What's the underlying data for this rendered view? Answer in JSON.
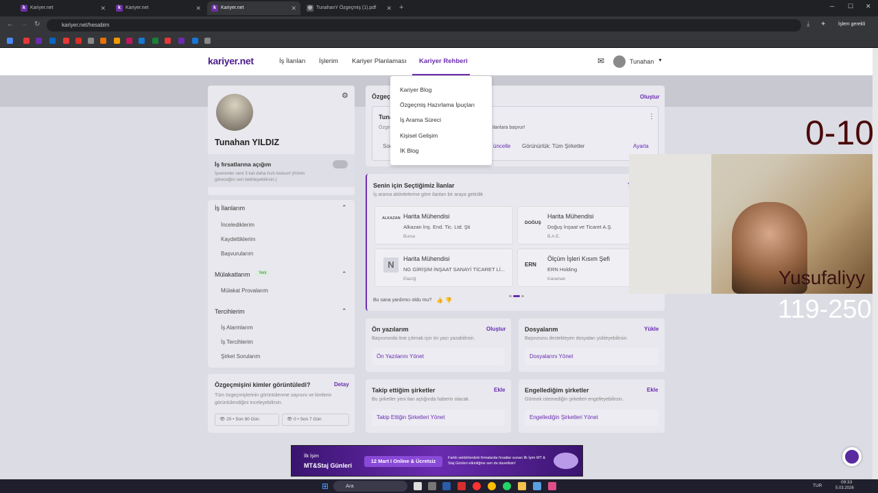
{
  "browser": {
    "tabs": [
      {
        "label": "Kariyer.net",
        "active": false
      },
      {
        "label": "Kariyer.net",
        "active": false
      },
      {
        "label": "Kariyer.net",
        "active": true
      },
      {
        "label": "TunahanY Özgeçmiş (1).pdf",
        "active": false
      }
    ],
    "url": "kariyer.net/hesabim",
    "profile_label": "İşlem gerekli"
  },
  "header": {
    "logo": "kariyer.net",
    "nav": [
      "İş İlanları",
      "İşlerim",
      "Kariyer Planlaması",
      "Kariyer Rehberi"
    ],
    "user": "Tunahan"
  },
  "dropdown": [
    "Kariyer Blog",
    "Özgeçmiş Hazırlama İpuçları",
    "İş Arama Süreci",
    "Kişisel Gelişim",
    "İK Blog"
  ],
  "profile": {
    "name": "Tunahan YILDIZ",
    "open_label": "İş fırsatlarına açığım",
    "open_desc": "İşverenler seni 3 kat daha hızlı bulsun! (Kimin göreceğini sen belirleyebilirsin.)"
  },
  "side": {
    "is_ilanlarim": {
      "title": "İş İlanlarım",
      "items": [
        "İncelediklerim",
        "Kaydettiklerim",
        "Başvurularım"
      ]
    },
    "mulakat": {
      "title": "Mülakatlarım",
      "badge": "Yeni",
      "items": [
        "Mülakat Provalarım"
      ]
    },
    "tercihler": {
      "title": "Tercihlerim",
      "items": [
        "İş Alarmlarım",
        "İş Tercihlerim",
        "Şirket Sorularım"
      ]
    },
    "viewed": {
      "title": "Özgeçmişini kimler görüntüledi?",
      "action": "Detay",
      "desc": "Tüm özgeçmişlerinin görüntülenme sayısını ve kimlerin görüntülendiğini inceleyebilirsin.",
      "stat1": "20 • Son 90 Gün",
      "stat2": "0 • Son 7 Gün"
    }
  },
  "cv": {
    "title": "Özgeç",
    "action": "Oluştur",
    "name_prefix": "Tuna",
    "desc_prefix": "Özge",
    "desc_suffix": "ilanlara başvur!",
    "edit_prefix": "Son",
    "edit_link": "üncelle",
    "visibility": "Görünürlük: Tüm Şirketler",
    "visibility_action": "Ayarla"
  },
  "recommended": {
    "title": "Senin için Seçtiğimiz İlanlar",
    "title_tail": "T",
    "subtitle": "İş arama aktivitelerine göre ilanları bir araya getirdik",
    "jobs": [
      {
        "title": "Harita Mühendisi",
        "company": "Alkazan İnş. End. Tic. Ltd. Şti",
        "city": "Bursa",
        "logo": "ALKAZAN"
      },
      {
        "title": "Harita Mühendisi",
        "company": "Doğuş İnşaat ve Ticaret A.Ş.",
        "city": "B.A.E.",
        "logo": "DOĞUŞ"
      },
      {
        "title": "Harita Mühendisi",
        "company": "NG GİRİŞİM İNŞAAT SANAYİ TİCARET Lİ...",
        "city": "Elazığ",
        "logo": "N"
      },
      {
        "title": "Ölçüm İşleri Kısım Şefi",
        "company": "ERN Holding",
        "city": "Karaman",
        "logo": "ERN"
      }
    ],
    "feedback": "Bu sana yardımcı oldu mu?"
  },
  "tiles": [
    {
      "title": "Ön yazılarım",
      "action": "Oluştur",
      "desc": "Başvurunda öne çıkmak için ön yazı yazabilirsin.",
      "link": "Ön Yazılarını Yönet"
    },
    {
      "title": "Dosyalarım",
      "action": "Yükle",
      "desc": "Başvurunu destekleyen dosyaları yükleyebilirsin.",
      "link": "Dosyalarını Yönet"
    },
    {
      "title": "Takip ettiğim şirketler",
      "action": "Ekle",
      "desc": "Bu şirketler yeni ilan açtığında haberin olacak.",
      "link": "Takip Ettiğin Şirketleri Yönet"
    },
    {
      "title": "Engellediğim şirketler",
      "action": "Ekle",
      "desc": "Görmek istemediğin şirketleri engelleyebilirsin.",
      "link": "Engellediğin Şirketleri Yönet"
    }
  ],
  "banner": {
    "left1": "İlk İşim",
    "left2": "MT&Staj Günleri",
    "pill": "12 Mart I Online & Ücretsiz",
    "right": "Farklı sektörlerdeki firmalarda fırsatlar sunan İlk İşim MT & Staj Günleri etkinliğine sen de davetlisin!"
  },
  "stream": {
    "score": "0-10",
    "name": "Yusufaliyy",
    "range": "119-250"
  },
  "taskbar": {
    "search": "Ara",
    "lang": "TUR",
    "time": "09:33",
    "date": "5.03.2026"
  },
  "colors": {
    "brand": "#6a2bb0",
    "header_logo": "#4a1a8c"
  }
}
